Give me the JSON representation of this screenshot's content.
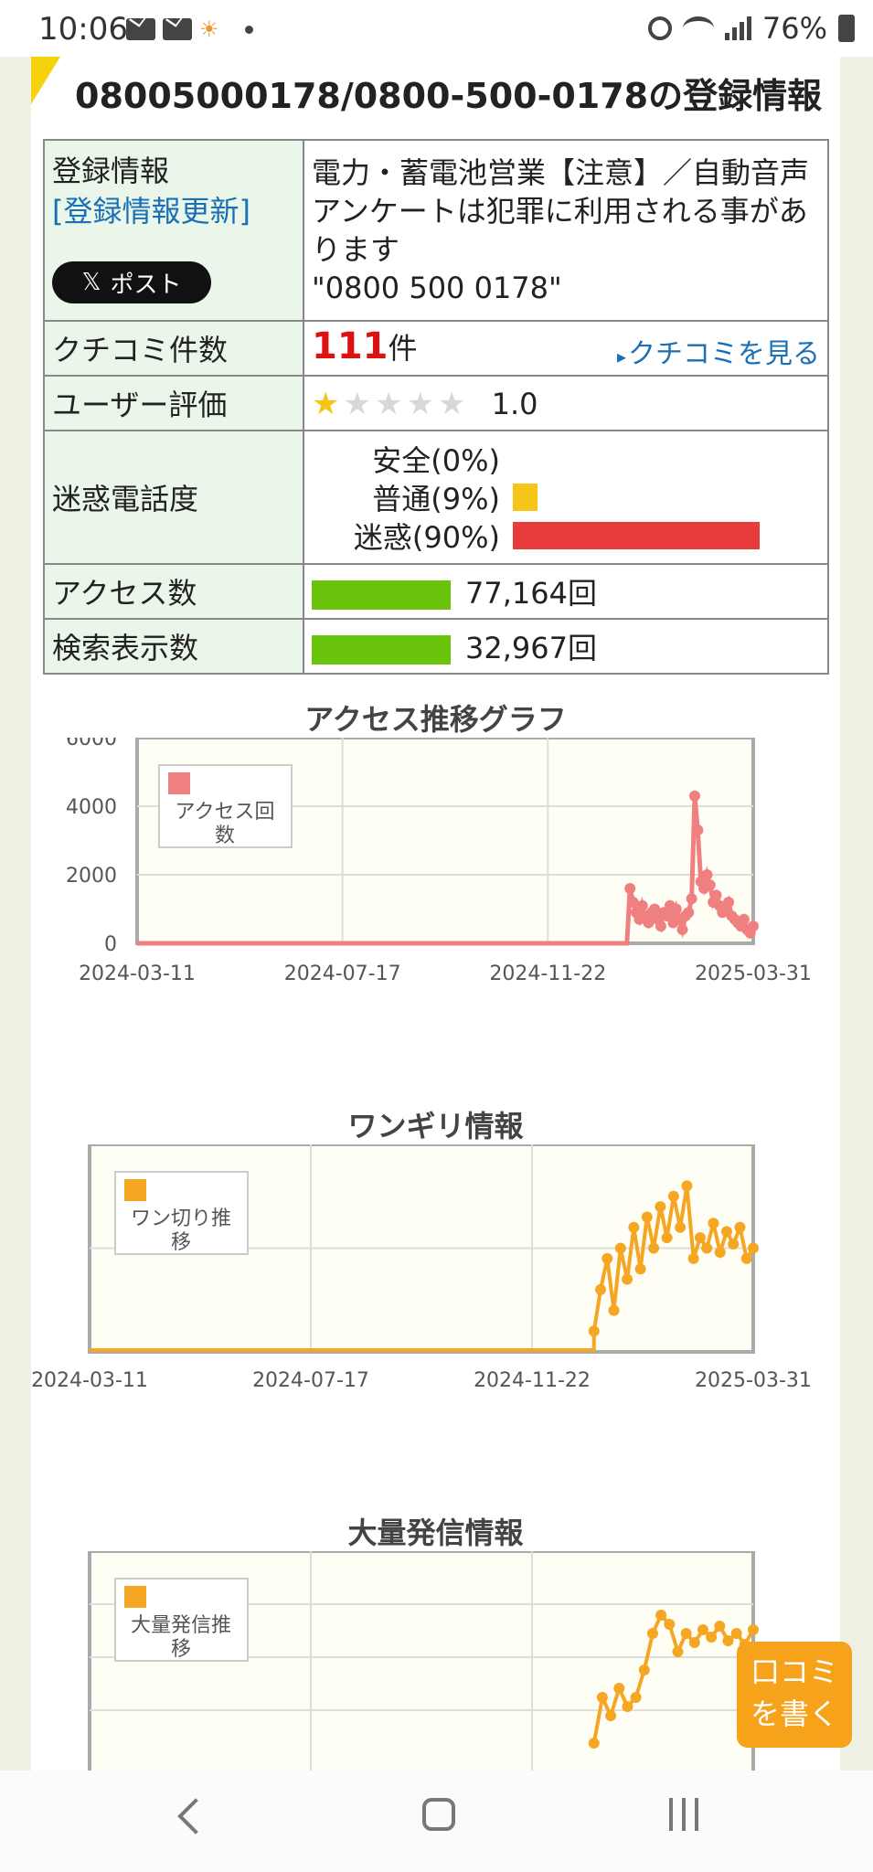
{
  "status_bar": {
    "time": "10:06",
    "battery": "76%",
    "icons": [
      "mail-icon",
      "mail-icon",
      "weather-icon",
      "notification-dot",
      "alarm-icon",
      "wifi-icon",
      "signal-icon",
      "battery-icon"
    ]
  },
  "page": {
    "title": "08005000178/0800-500-0178の登録情報"
  },
  "info": {
    "registration_label": "登録情報",
    "update_link": "[登録情報更新]",
    "post_button": "ポスト",
    "registration_desc": "電力・蓄電池営業【注意】／自動音声アンケートは犯罪に利用される事があります",
    "phone_quoted": "\"0800 500 0178\"",
    "review_count_label": "クチコミ件数",
    "review_count": "111",
    "review_count_unit": "件",
    "see_reviews": "クチコミを見る",
    "user_rating_label": "ユーザー評価",
    "rating": "1.0",
    "rating_stars": 1,
    "nuisance_label": "迷惑電話度",
    "nuisance": [
      {
        "label": "安全(0%)",
        "fraction": 0.0,
        "color": "#f5c518"
      },
      {
        "label": "普通(9%)",
        "fraction": 0.09,
        "color": "#f5c518"
      },
      {
        "label": "迷惑(90%)",
        "fraction": 0.9,
        "color": "#e83b3b"
      }
    ],
    "access_label": "アクセス数",
    "access_count": "77,164回",
    "search_label": "検索表示数",
    "search_count": "32,967回",
    "bar_color": "#6ac40c"
  },
  "charts": [
    {
      "type": "line",
      "title": "アクセス推移グラフ",
      "series_name": "アクセス回数",
      "color": "#f08080",
      "y_ticks": [
        "6000",
        "4000",
        "2000",
        "0"
      ],
      "x_ticks": [
        "2024-03-11",
        "2024-07-17",
        "2024-11-22",
        "2025-03-31"
      ],
      "ylim": [
        0,
        6000
      ],
      "x": [
        0,
        5,
        10,
        15,
        20,
        25,
        30,
        35,
        40,
        45,
        50,
        55,
        60,
        65,
        70,
        75,
        80,
        85,
        90,
        95,
        100,
        105,
        110,
        115,
        120,
        125,
        130,
        135,
        140,
        145,
        150,
        155,
        160,
        165,
        170,
        175,
        180,
        185,
        190,
        195,
        200,
        205,
        210,
        215,
        220,
        225,
        230,
        235,
        240,
        245,
        250,
        255,
        260,
        265,
        270,
        275,
        280,
        285,
        290,
        295,
        300,
        305,
        310,
        315,
        320,
        325,
        330,
        335,
        340,
        345,
        350,
        355,
        360,
        365,
        370,
        375,
        380,
        385,
        390,
        395,
        400,
        405,
        410,
        415,
        420,
        425,
        430,
        435,
        440,
        445,
        450,
        455,
        460,
        465,
        470,
        475,
        480,
        485,
        490,
        495,
        500,
        505,
        510,
        515,
        520,
        525,
        530,
        535,
        540,
        545,
        550,
        555,
        560,
        565,
        570,
        575,
        580,
        585,
        590,
        595,
        600,
        605,
        610,
        615,
        620,
        625,
        630,
        635,
        640,
        645,
        650,
        655,
        660,
        665,
        670,
        675,
        680,
        685,
        690,
        695,
        700,
        705,
        710,
        715,
        720,
        725,
        730,
        735,
        740,
        745,
        750,
        755,
        760,
        765,
        770,
        775,
        780,
        785,
        790,
        795,
        800,
        805,
        810,
        815,
        820,
        825,
        830,
        835,
        840,
        845,
        850,
        855,
        860,
        865,
        870,
        875,
        880,
        885,
        890,
        895,
        900,
        905,
        910,
        915,
        920,
        925,
        930,
        935,
        940,
        945,
        950,
        955,
        960,
        965,
        970,
        975,
        980,
        985,
        990,
        995,
        1000
      ],
      "y": [
        0,
        0,
        0,
        0,
        0,
        0,
        0,
        0,
        0,
        0,
        0,
        0,
        0,
        0,
        0,
        0,
        0,
        0,
        0,
        0,
        0,
        0,
        0,
        0,
        0,
        0,
        0,
        0,
        0,
        0,
        0,
        0,
        0,
        0,
        0,
        0,
        0,
        0,
        0,
        0,
        0,
        0,
        0,
        0,
        0,
        0,
        0,
        0,
        0,
        0,
        0,
        0,
        0,
        0,
        0,
        0,
        0,
        0,
        0,
        0,
        0,
        0,
        0,
        0,
        0,
        0,
        0,
        0,
        0,
        0,
        0,
        0,
        0,
        0,
        0,
        0,
        0,
        0,
        0,
        0,
        0,
        0,
        0,
        0,
        0,
        0,
        0,
        0,
        0,
        0,
        0,
        0,
        0,
        0,
        0,
        0,
        0,
        0,
        0,
        0,
        0,
        0,
        0,
        0,
        0,
        0,
        0,
        0,
        0,
        0,
        0,
        0,
        0,
        0,
        0,
        0,
        0,
        0,
        0,
        0,
        0,
        0,
        0,
        0,
        0,
        0,
        0,
        0,
        0,
        0,
        0,
        0,
        0,
        0,
        0,
        0,
        0,
        0,
        0,
        0,
        0,
        0,
        0,
        0,
        0,
        0,
        0,
        0,
        0,
        0,
        0,
        0,
        0,
        0,
        0,
        0,
        0,
        0,
        0,
        0,
        1600,
        1200,
        900,
        700,
        1100,
        800,
        600,
        900,
        1000,
        700,
        500,
        900,
        800,
        1100,
        600,
        1000,
        700,
        400,
        800,
        900,
        1300,
        4300,
        3300,
        1800,
        1600,
        2000,
        1700,
        1200,
        1400,
        1100,
        900,
        1000,
        1200,
        800,
        700,
        600,
        500,
        700,
        400,
        300,
        500,
        400,
        300,
        200,
        300,
        200,
        200,
        300,
        100,
        200,
        300
      ]
    },
    {
      "type": "line",
      "title": "ワンギリ情報",
      "series_name": "ワン切り推移",
      "color": "#f5a623",
      "x_ticks": [
        "2024-03-11",
        "2024-07-17",
        "2024-11-22",
        "2025-03-31"
      ]
    },
    {
      "type": "line",
      "title": "大量発信情報",
      "series_name": "大量発信推移",
      "color": "#f5a623"
    }
  ],
  "fab": {
    "line1": "口コミ",
    "line2": "を書く"
  }
}
